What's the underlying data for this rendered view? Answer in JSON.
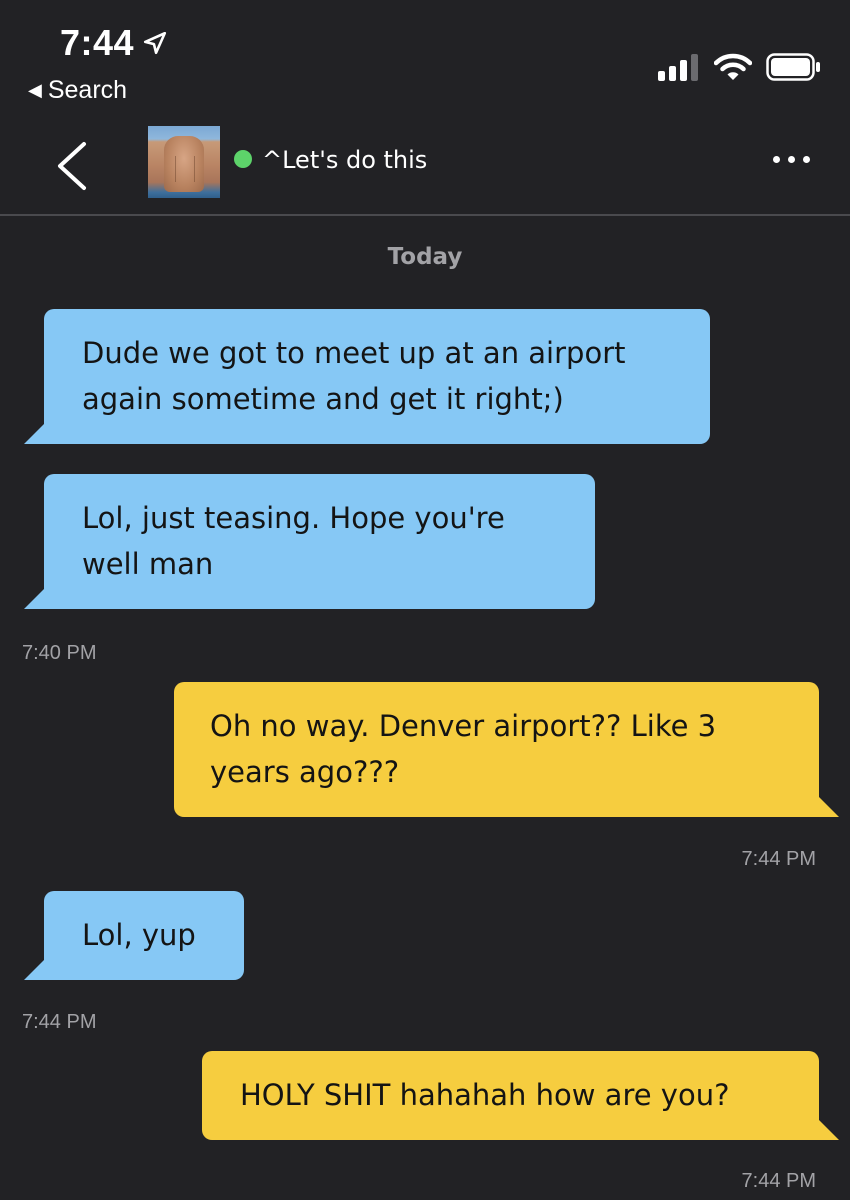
{
  "status_bar": {
    "time": "7:44",
    "back_app_label": "Search",
    "icons": [
      "location-arrow-icon",
      "cellular-signal-icon",
      "wifi-icon",
      "battery-icon"
    ]
  },
  "header": {
    "contact_name": "^Let's do this",
    "online_status_color": "#5dd36a",
    "icons": [
      "back-chevron-icon",
      "more-options-icon"
    ]
  },
  "chat": {
    "date_separator": "Today",
    "messages": [
      {
        "direction": "incoming",
        "lines": [
          "Dude we got to meet up at an airport",
          "again sometime and get it right;)"
        ]
      },
      {
        "direction": "incoming",
        "lines": [
          "Lol, just teasing. Hope you're",
          "well man"
        ],
        "time": "7:40 PM"
      },
      {
        "direction": "outgoing",
        "lines": [
          "Oh no way. Denver airport?? Like 3",
          "years ago???"
        ],
        "time": "7:44 PM"
      },
      {
        "direction": "incoming",
        "lines": [
          "Lol, yup"
        ],
        "time": "7:44 PM"
      },
      {
        "direction": "outgoing",
        "lines": [
          "HOLY SHIT hahahah how are you?"
        ],
        "time": "7:44 PM"
      }
    ]
  },
  "colors": {
    "background": "#222225",
    "incoming_bubble": "#86c8f5",
    "outgoing_bubble": "#f6cd3f",
    "timestamp_text": "#a2a2a6"
  }
}
